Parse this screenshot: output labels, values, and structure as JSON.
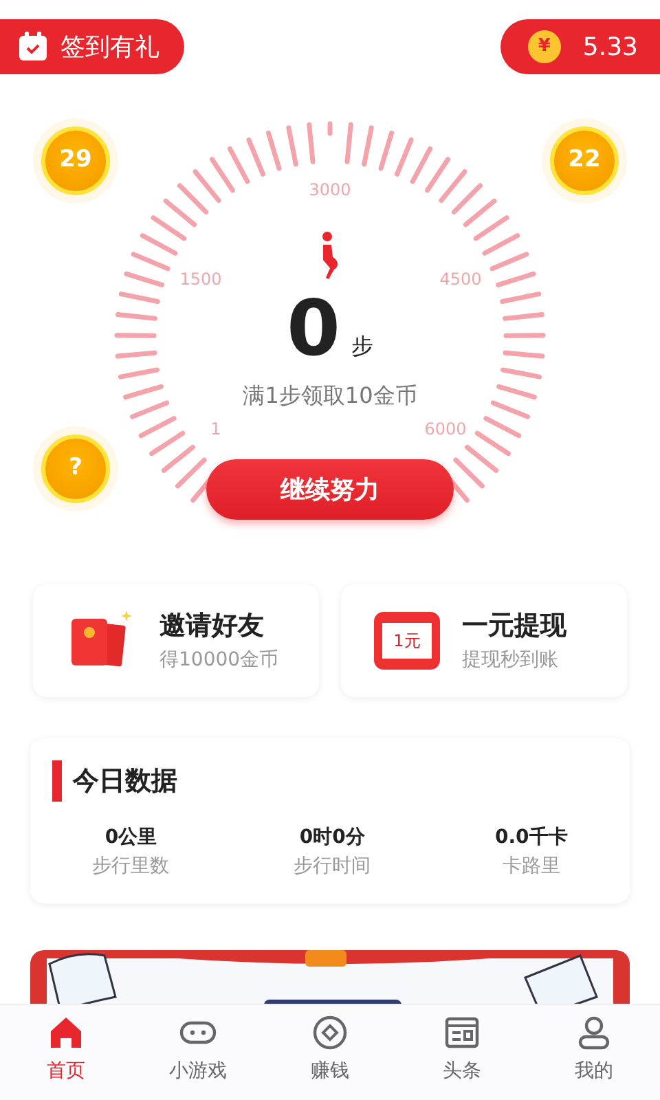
{
  "header": {
    "checkin_label": "签到有礼",
    "currency_symbol": "¥",
    "balance": "5.33"
  },
  "gauge": {
    "scale_labels": [
      "1",
      "1500",
      "3000",
      "4500",
      "6000"
    ],
    "steps": "0",
    "unit": "步",
    "hint": "满1步领取10金币",
    "button": "继续努力"
  },
  "coins": [
    {
      "label": "29"
    },
    {
      "label": "22"
    },
    {
      "label": "?"
    }
  ],
  "promo_cards": [
    {
      "kind": "invite",
      "title": "邀请好友",
      "subtitle": "得10000金币"
    },
    {
      "kind": "withdraw",
      "badge": "1元",
      "title": "一元提现",
      "subtitle": "提现秒到账"
    }
  ],
  "today": {
    "title": "今日数据",
    "stats": [
      {
        "value": "0公里",
        "label": "步行里数"
      },
      {
        "value": "0时0分",
        "label": "步行时间"
      },
      {
        "value": "0.0千卡",
        "label": "卡路里"
      }
    ]
  },
  "bottom_nav": [
    {
      "kind": "home",
      "label": "首页",
      "selected": true
    },
    {
      "kind": "game",
      "label": "小游戏",
      "selected": false
    },
    {
      "kind": "coin",
      "label": "赚钱",
      "selected": false
    },
    {
      "kind": "news",
      "label": "头条",
      "selected": false
    },
    {
      "kind": "user",
      "label": "我的",
      "selected": false
    }
  ]
}
